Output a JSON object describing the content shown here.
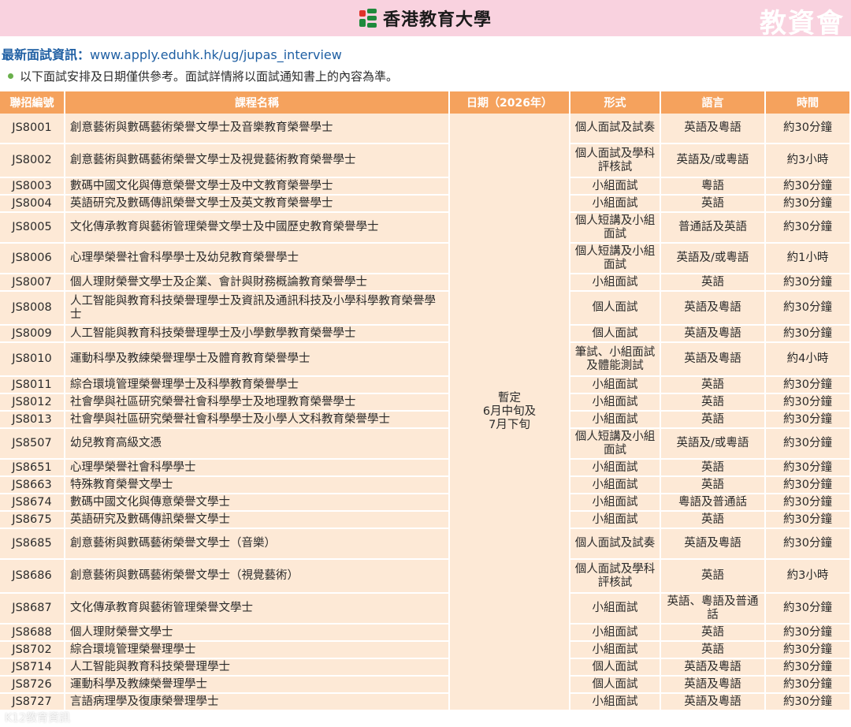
{
  "header": {
    "brand": "香港教育大學",
    "tag": "教資會"
  },
  "info": {
    "label": "最新面試資訊：",
    "url": "www.apply.eduhk.hk/ug/jupas_interview",
    "note": "以下面試安排及日期僅供參考。面試詳情將以面試通知書上的內容為準。"
  },
  "table": {
    "headers": [
      "聯招編號",
      "課程名稱",
      "日期（2026年）",
      "形式",
      "語言",
      "時間"
    ],
    "date_cell": [
      "暫定",
      "6月中旬及",
      "7月下旬"
    ],
    "rows": [
      {
        "code": "JS8001",
        "name": "創意藝術與數碼藝術榮譽文學士及音樂教育榮譽學士",
        "format": "個人面試及試奏",
        "lang": "英語及粵語",
        "time": "約30分鐘"
      },
      {
        "code": "JS8002",
        "name": "創意藝術與數碼藝術榮譽文學士及視覺藝術教育榮譽學士",
        "format": "個人面試及學科評核試",
        "lang": "英語及/或粵語",
        "time": "約3小時"
      },
      {
        "code": "JS8003",
        "name": "數碼中國文化與傳意榮譽文學士及中文教育榮譽學士",
        "format": "小組面試",
        "lang": "粵語",
        "time": "約30分鐘"
      },
      {
        "code": "JS8004",
        "name": "英語研究及數碼傳訊榮譽文學士及英文教育榮譽學士",
        "format": "小組面試",
        "lang": "英語",
        "time": "約30分鐘"
      },
      {
        "code": "JS8005",
        "name": "文化傳承教育與藝術管理榮譽文學士及中國歷史教育榮譽學士",
        "format": "個人短講及小組面試",
        "lang": "普通話及英語",
        "time": "約30分鐘"
      },
      {
        "code": "JS8006",
        "name": "心理學榮譽社會科學學士及幼兒教育榮譽學士",
        "format": "個人短講及小組面試",
        "lang": "英語及/或粵語",
        "time": "約1小時"
      },
      {
        "code": "JS8007",
        "name": "個人理財榮譽文學士及企業、會計與財務概論教育榮譽學士",
        "format": "小組面試",
        "lang": "英語",
        "time": "約30分鐘"
      },
      {
        "code": "JS8008",
        "name": "人工智能與教育科技榮譽理學士及資訊及通訊科技及小學科學教育榮譽學士",
        "format": "個人面試",
        "lang": "英語及粵語",
        "time": "約30分鐘"
      },
      {
        "code": "JS8009",
        "name": "人工智能與教育科技榮譽理學士及小學數學教育榮譽學士",
        "format": "個人面試",
        "lang": "英語及粵語",
        "time": "約30分鐘"
      },
      {
        "code": "JS8010",
        "name": "運動科學及教練榮譽理學士及體育教育榮譽學士",
        "format": "筆試、小組面試及體能測試",
        "lang": "英語及粵語",
        "time": "約4小時"
      },
      {
        "code": "JS8011",
        "name": "綜合環境管理榮譽理學士及科學教育榮譽學士",
        "format": "小組面試",
        "lang": "英語",
        "time": "約30分鐘"
      },
      {
        "code": "JS8012",
        "name": "社會學與社區研究榮譽社會科學學士及地理教育榮譽學士",
        "format": "小組面試",
        "lang": "英語",
        "time": "約30分鐘"
      },
      {
        "code": "JS8013",
        "name": "社會學與社區研究榮譽社會科學學士及小學人文科教育榮譽學士",
        "format": "小組面試",
        "lang": "英語",
        "time": "約30分鐘"
      },
      {
        "code": "JS8507",
        "name": "幼兒教育高級文憑",
        "format": "個人短講及小組面試",
        "lang": "英語及/或粵語",
        "time": "約30分鐘"
      },
      {
        "code": "JS8651",
        "name": "心理學榮譽社會科學學士",
        "format": "小組面試",
        "lang": "英語",
        "time": "約30分鐘"
      },
      {
        "code": "JS8663",
        "name": "特殊教育榮譽文學士",
        "format": "小組面試",
        "lang": "英語",
        "time": "約30分鐘"
      },
      {
        "code": "JS8674",
        "name": "數碼中國文化與傳意榮譽文學士",
        "format": "小組面試",
        "lang": "粵語及普通話",
        "time": "約30分鐘"
      },
      {
        "code": "JS8675",
        "name": "英語研究及數碼傳訊榮譽文學士",
        "format": "小組面試",
        "lang": "英語",
        "time": "約30分鐘"
      },
      {
        "code": "JS8685",
        "name": "創意藝術與數碼藝術榮譽文學士（音樂）",
        "format": "個人面試及試奏",
        "lang": "英語及粵語",
        "time": "約30分鐘"
      },
      {
        "code": "JS8686",
        "name": "創意藝術與數碼藝術榮譽文學士（視覺藝術）",
        "format": "個人面試及學科評核試",
        "lang": "英語",
        "time": "約3小時"
      },
      {
        "code": "JS8687",
        "name": "文化傳承教育與藝術管理榮譽文學士",
        "format": "小組面試",
        "lang": "英語、粵語及普通話",
        "time": "約30分鐘"
      },
      {
        "code": "JS8688",
        "name": "個人理財榮譽文學士",
        "format": "小組面試",
        "lang": "英語",
        "time": "約30分鐘"
      },
      {
        "code": "JS8702",
        "name": "綜合環境管理榮譽理學士",
        "format": "小組面試",
        "lang": "英語",
        "time": "約30分鐘"
      },
      {
        "code": "JS8714",
        "name": "人工智能與教育科技榮譽理學士",
        "format": "個人面試",
        "lang": "英語及粵語",
        "time": "約30分鐘"
      },
      {
        "code": "JS8726",
        "name": "運動科學及教練榮譽理學士",
        "format": "個人面試",
        "lang": "英語及粵語",
        "time": "約30分鐘"
      },
      {
        "code": "JS8727",
        "name": "言語病理學及復康榮譽理學士",
        "format": "小組面試",
        "lang": "英語及粵語",
        "time": "約30分鐘"
      }
    ]
  },
  "watermark": "K12教育資訊"
}
